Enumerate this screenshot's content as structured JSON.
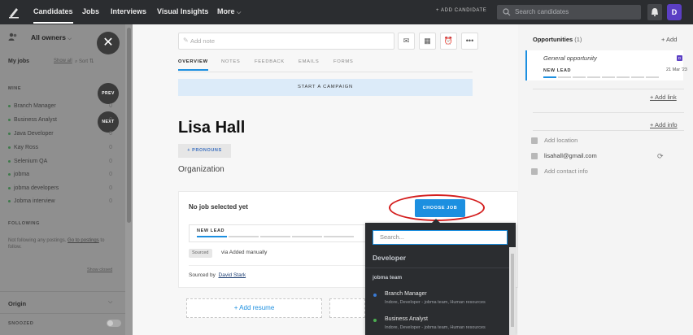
{
  "nav": {
    "items": [
      "Candidates",
      "Jobs",
      "Interviews",
      "Visual Insights",
      "More"
    ],
    "add_candidate": "+ ADD CANDIDATE",
    "search_placeholder": "Search candidates",
    "avatar": "D"
  },
  "sidebar": {
    "owners": "All owners",
    "close_glyph": "✕",
    "prev": "PREV",
    "next": "NEXT",
    "my_jobs": "My jobs",
    "show_all": "Show all",
    "sort": "Sort",
    "mine": "MINE",
    "jobs": [
      {
        "name": "Branch Manager",
        "count": "0"
      },
      {
        "name": "Business Analyst",
        "count": "0"
      },
      {
        "name": "Java Developer",
        "count": "0"
      },
      {
        "name": "Kay Ross",
        "count": "0"
      },
      {
        "name": "Selenium QA",
        "count": "0"
      },
      {
        "name": "jobma",
        "count": "0"
      },
      {
        "name": "jobma developers",
        "count": "0"
      },
      {
        "name": "Jobma interview",
        "count": "0"
      }
    ],
    "following": "FOLLOWING",
    "following_text_1": "Not following any postings.",
    "following_link": "Go to postings",
    "following_text_2": "to follow.",
    "show_closed": "Show closed",
    "origin": "Origin",
    "snoozed": "SNOOZED"
  },
  "main": {
    "note_placeholder": "Add note",
    "tabs": [
      "OVERVIEW",
      "NOTES",
      "FEEDBACK",
      "EMAILS",
      "FORMS"
    ],
    "campaign": "START A CAMPAIGN",
    "name": "Lisa Hall",
    "pronouns": "+ PRONOUNS",
    "organization": "Organization",
    "no_job": "No job selected yet",
    "choose_job": "CHOOSE JOB",
    "stage": "NEW LEAD",
    "sourced_tag": "Sourced",
    "via": "via Added manually",
    "sourced_by": "Sourced by",
    "sourced_by_name": "David Stark",
    "add_resume": "+ Add resume"
  },
  "dropdown": {
    "search_placeholder": "Search...",
    "group": "Developer",
    "team": "jobma team",
    "items": [
      {
        "title": "Branch Manager",
        "subtitle": "Indore, Developer - jobma team, Human resources",
        "color": "#3a7bd5"
      },
      {
        "title": "Business Analyst",
        "subtitle": "Indore, Developer - jobma team, Human resources",
        "color": "#4caf50"
      }
    ]
  },
  "right": {
    "opportunities": "Opportunities",
    "opp_count": "(1)",
    "add": "+ Add",
    "opp_name": "General opportunity",
    "opp_stage": "NEW LEAD",
    "opp_date": "21 Mar '23",
    "add_link": "+ Add link",
    "add_info": "+ Add info",
    "add_location": "Add location",
    "email": "lisahall@gmail.com",
    "add_contact": "Add contact info"
  }
}
